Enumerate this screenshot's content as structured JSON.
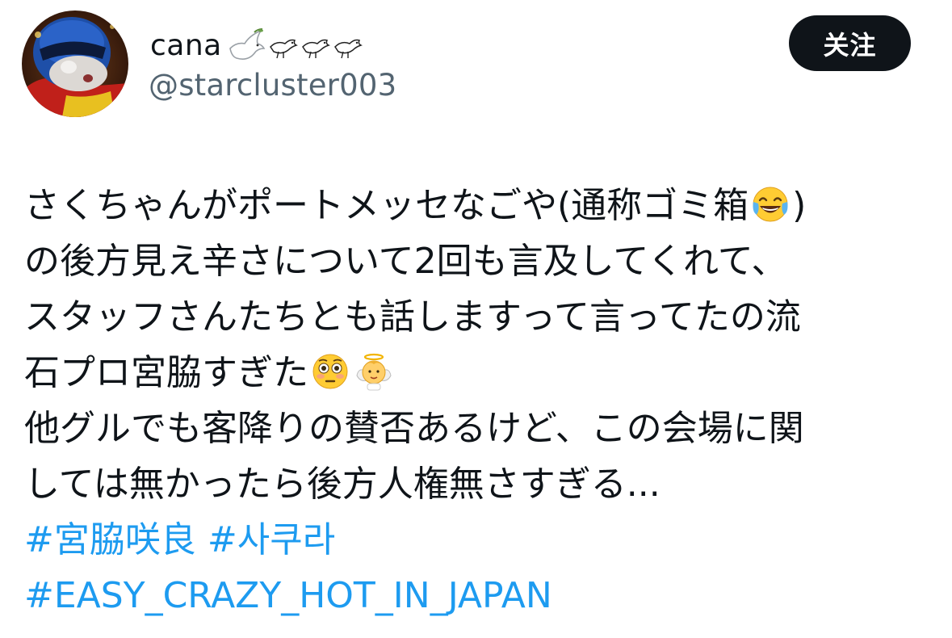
{
  "author": {
    "display_name": "cana",
    "handle": "@starcluster003",
    "avatar": "avatar-icon",
    "name_emojis": [
      "dove-icon",
      "bird-icon",
      "bird-icon",
      "bird-icon"
    ]
  },
  "follow_button": {
    "label": "关注"
  },
  "tweet": {
    "lines": [
      "さくちゃんがポートメッセなごや(通称ゴミ箱",
      ")",
      "の後方見え辛さについて2回も言及してくれて、",
      "スタッフさんたちとも話しますって言ってたの流",
      "石プロ宮脇すぎた",
      "他グルでも客降りの賛否あるけど、この会場に関",
      "しては無かったら後方人権無さすぎる..."
    ],
    "emojis": {
      "laughing": "tears-of-joy-icon",
      "flushed": "flushed-face-icon",
      "angel": "baby-angel-icon"
    },
    "hashtags": [
      "#宮脇咲良",
      "#사쿠라",
      "#EASY_CRAZY_HOT_IN_JAPAN"
    ]
  },
  "colors": {
    "text": "#0f1419",
    "secondary": "#536471",
    "link": "#1d9bf0",
    "button_bg": "#0f1419",
    "button_text": "#ffffff"
  }
}
